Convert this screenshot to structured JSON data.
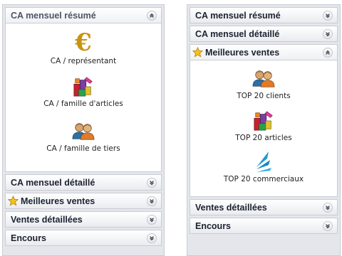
{
  "left_panel": {
    "sections": [
      {
        "title": "CA mensuel résumé",
        "expanded": true,
        "chevron": "collapse-up"
      },
      {
        "title": "CA mensuel détaillé",
        "expanded": false,
        "chevron": "expand-down"
      },
      {
        "title": "Meilleures ventes",
        "expanded": false,
        "chevron": "expand-down",
        "icon": "star-icon"
      },
      {
        "title": "Ventes détaillées",
        "expanded": false,
        "chevron": "expand-down"
      },
      {
        "title": "Encours",
        "expanded": false,
        "chevron": "expand-down"
      }
    ],
    "items": [
      {
        "label": "CA / représentant",
        "icon": "euro-icon"
      },
      {
        "label": "CA / famille d'articles",
        "icon": "product-blocks-icon"
      },
      {
        "label": "CA / famille de tiers",
        "icon": "people-icon"
      }
    ]
  },
  "right_panel": {
    "sections": [
      {
        "title": "CA mensuel résumé",
        "expanded": false,
        "chevron": "expand-down"
      },
      {
        "title": "CA mensuel détaillé",
        "expanded": false,
        "chevron": "expand-down"
      },
      {
        "title": "Meilleures ventes",
        "expanded": true,
        "chevron": "collapse-up",
        "icon": "star-icon"
      },
      {
        "title": "Ventes détaillées",
        "expanded": false,
        "chevron": "expand-down"
      },
      {
        "title": "Encours",
        "expanded": false,
        "chevron": "expand-down"
      }
    ],
    "items": [
      {
        "label": "TOP 20 clients",
        "icon": "people-icon"
      },
      {
        "label": "TOP 20 articles",
        "icon": "product-blocks-icon"
      },
      {
        "label": "TOP 20 commerciaux",
        "icon": "sales-arrow-icon"
      }
    ]
  },
  "colors": {
    "euro": "#c9930e",
    "star": "#f4c21f",
    "header_text": "#1b2231"
  }
}
